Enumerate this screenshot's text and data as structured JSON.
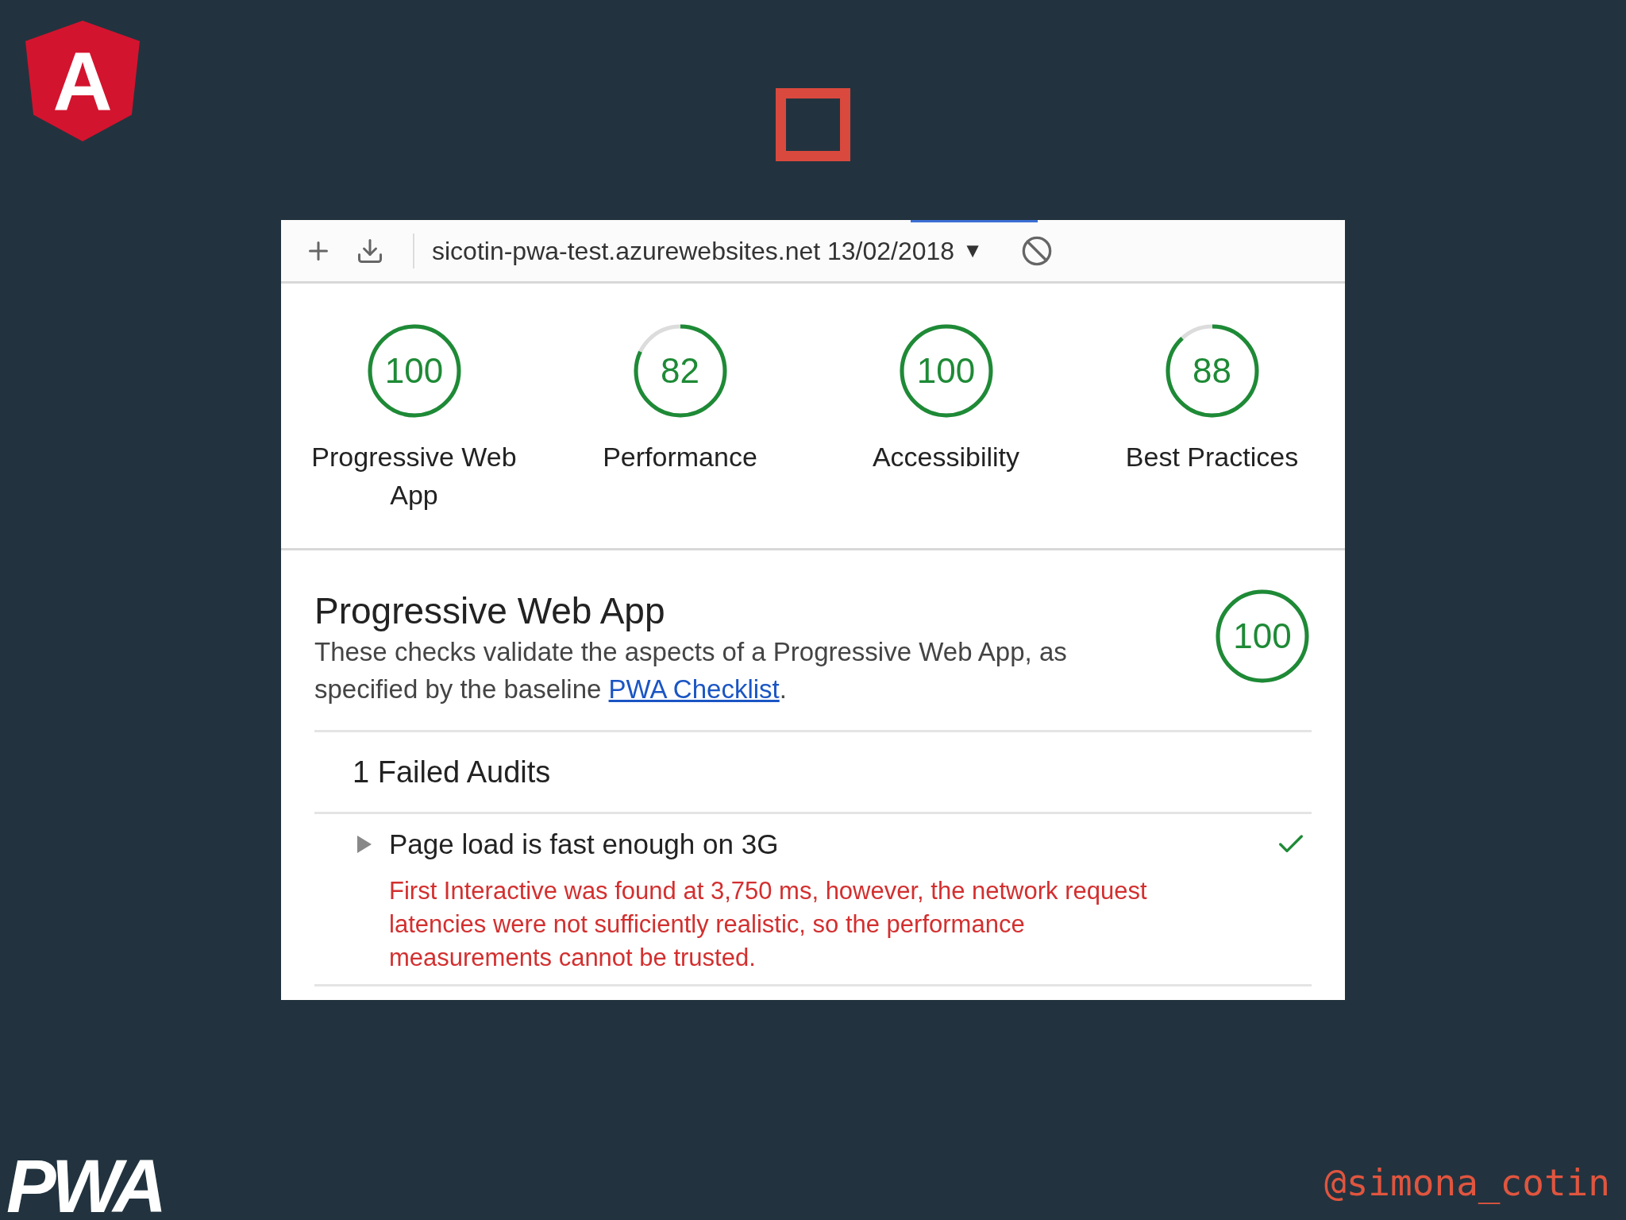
{
  "slide": {
    "logo_letter": "A",
    "pwa_logo": "PWA",
    "handle": "@simona_cotin"
  },
  "toolbar": {
    "report": "sicotin-pwa-test.azurewebsites.net 13/02/2018",
    "dropdown": "▼"
  },
  "gauges": [
    {
      "score": "100",
      "label": "Progressive Web App"
    },
    {
      "score": "82",
      "label": "Performance"
    },
    {
      "score": "100",
      "label": "Accessibility"
    },
    {
      "score": "88",
      "label": "Best Practices"
    }
  ],
  "section": {
    "title": "Progressive Web App",
    "description_start": "These checks validate the aspects of a Progressive Web App, as specified by the baseline ",
    "link": "PWA Checklist",
    "description_end": ".",
    "score": "100"
  },
  "failed_heading": "1 Failed Audits",
  "audits": [
    {
      "title": "Page load is fast enough on 3G",
      "passed": true,
      "details": "First Interactive was found at 3,750 ms, however, the network request latencies were not sufficiently realistic, so the performance measurements cannot be trusted."
    }
  ]
}
